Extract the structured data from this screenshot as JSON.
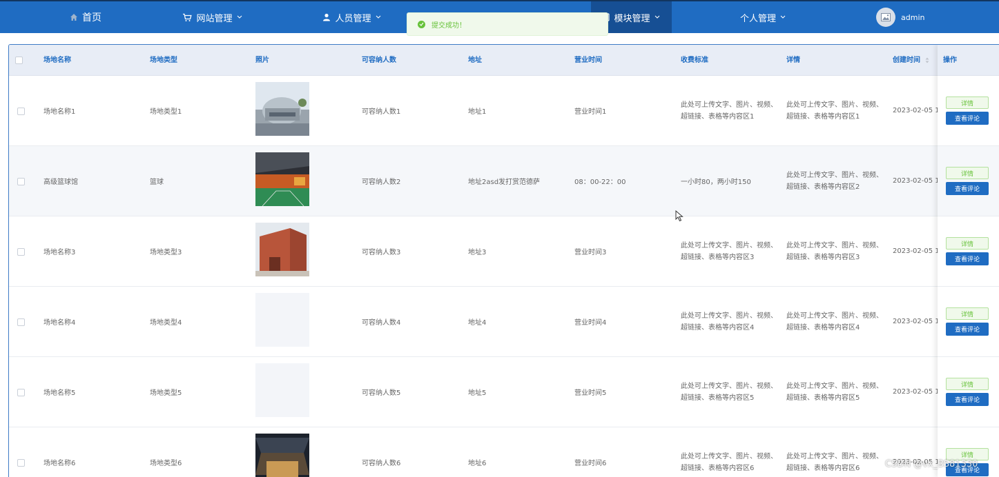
{
  "nav": {
    "home": "首页",
    "website": "网站管理",
    "staff": "人员管理",
    "module": "模块管理",
    "personal": "个人管理",
    "user": "admin"
  },
  "toast": {
    "message": "提交成功！",
    "color": "#67c23a"
  },
  "table": {
    "headers": {
      "name": "场地名称",
      "type": "场地类型",
      "photo": "照片",
      "capacity": "可容纳人数",
      "address": "地址",
      "hours": "营业时间",
      "fee": "收费标准",
      "detail": "详情",
      "created": "创建时间",
      "ops": "操作"
    },
    "rows": [
      {
        "name": "场地名称1",
        "type": "场地类型1",
        "capacity": "可容纳人数1",
        "address": "地址1",
        "hours": "营业时间1",
        "fee": "此处可上传文字、图片、视频、超链接、表格等内容区1",
        "detail": "此处可上传文字、图片、视频、超链接、表格等内容区1",
        "created": "2023-02-05 1"
      },
      {
        "name": "高级篮球馆",
        "type": "篮球",
        "capacity": "可容纳人数2",
        "address": "地址2asd发打赏范德萨",
        "hours": "08：00-22：00",
        "fee": "一小时80，两小时150",
        "detail": "此处可上传文字、图片、视频、超链接、表格等内容区2",
        "created": "2023-02-05 1"
      },
      {
        "name": "场地名称3",
        "type": "场地类型3",
        "capacity": "可容纳人数3",
        "address": "地址3",
        "hours": "营业时间3",
        "fee": "此处可上传文字、图片、视频、超链接、表格等内容区3",
        "detail": "此处可上传文字、图片、视频、超链接、表格等内容区3",
        "created": "2023-02-05 1"
      },
      {
        "name": "场地名称4",
        "type": "场地类型4",
        "capacity": "可容纳人数4",
        "address": "地址4",
        "hours": "营业时间4",
        "fee": "此处可上传文字、图片、视频、超链接、表格等内容区4",
        "detail": "此处可上传文字、图片、视频、超链接、表格等内容区4",
        "created": "2023-02-05 1"
      },
      {
        "name": "场地名称5",
        "type": "场地类型5",
        "capacity": "可容纳人数5",
        "address": "地址5",
        "hours": "营业时间5",
        "fee": "此处可上传文字、图片、视频、超链接、表格等内容区5",
        "detail": "此处可上传文字、图片、视频、超链接、表格等内容区5",
        "created": "2023-02-05 1"
      },
      {
        "name": "场地名称6",
        "type": "场地类型6",
        "capacity": "可容纳人数6",
        "address": "地址6",
        "hours": "营业时间6",
        "fee": "此处可上传文字、图片、视频、超链接、表格等内容区6",
        "detail": "此处可上传文字、图片、视频、超链接、表格等内容区6",
        "created": "2023-02-05 1"
      }
    ],
    "actions": {
      "detail": "详情",
      "comment": "查看评论"
    }
  },
  "watermark": "CSDN @vx_BS81330",
  "colors": {
    "nav": "#1f6cc2",
    "nav_active": "#164f94",
    "header_bg": "#e8edf6",
    "primary": "#1f6cc2",
    "success": "#67c23a"
  }
}
